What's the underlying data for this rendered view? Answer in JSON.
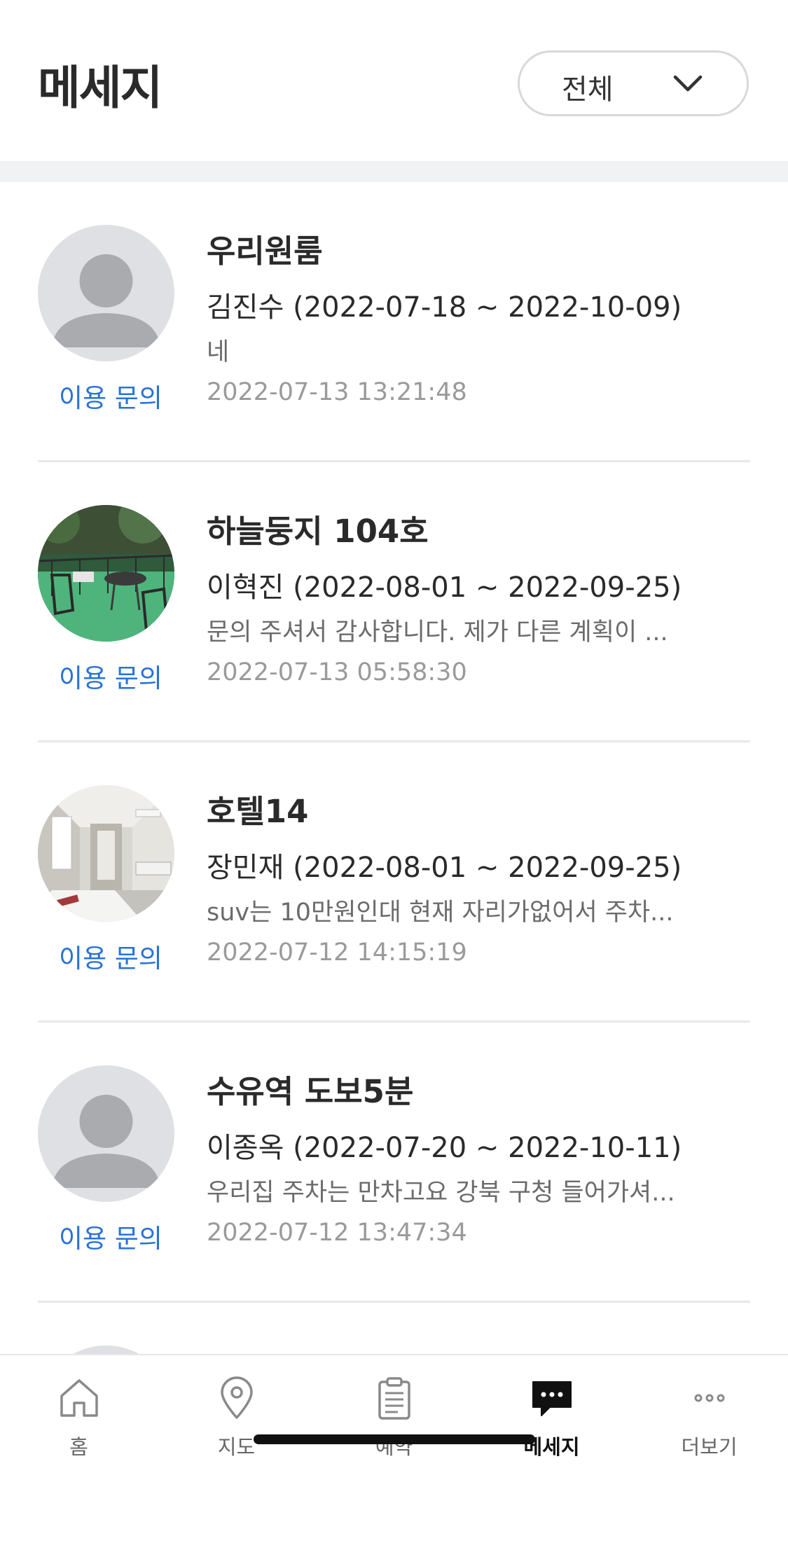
{
  "header": {
    "title": "메세지",
    "filter": {
      "selected": "전체"
    }
  },
  "messages": [
    {
      "name": "우리원룸",
      "guest": "김진수 (2022-07-18 ~ 2022-10-09)",
      "preview": "네",
      "time": "2022-07-13 13:21:48",
      "type": "이용 문의",
      "avatar": "default-avatar"
    },
    {
      "name": "하늘둥지 104호",
      "guest": "이혁진 (2022-08-01 ~ 2022-09-25)",
      "preview": "문의 주셔서 감사합니다. 제가 다른 계획이 ...",
      "time": "2022-07-13 05:58:30",
      "type": "이용 문의",
      "avatar": "rooftop-photo"
    },
    {
      "name": "호텔14",
      "guest": "장민재 (2022-08-01 ~ 2022-09-25)",
      "preview": "suv는 10만원인대 현재 자리가없어서 주차...",
      "time": "2022-07-12 14:15:19",
      "type": "이용 문의",
      "avatar": "hallway-photo"
    },
    {
      "name": "수유역 도보5분",
      "guest": "이종옥 (2022-07-20 ~ 2022-10-11)",
      "preview": "우리집 주차는 만차고요 강북 구청 들어가셔...",
      "time": "2022-07-12 13:47:34",
      "type": "이용 문의",
      "avatar": "default-avatar"
    }
  ],
  "tabbar": {
    "items": [
      {
        "label": "홈",
        "icon": "home-icon",
        "active": false
      },
      {
        "label": "지도",
        "icon": "map-pin-icon",
        "active": false
      },
      {
        "label": "예약",
        "icon": "clipboard-icon",
        "active": false
      },
      {
        "label": "메세지",
        "icon": "chat-icon",
        "active": true
      },
      {
        "label": "더보기",
        "icon": "more-icon",
        "active": false
      }
    ]
  },
  "colors": {
    "accent_blue": "#2a72d6",
    "band_gray": "#f1f2f4",
    "avatar_gray": "#dfe0e3",
    "avatar_silhouette": "#a9abaf"
  }
}
